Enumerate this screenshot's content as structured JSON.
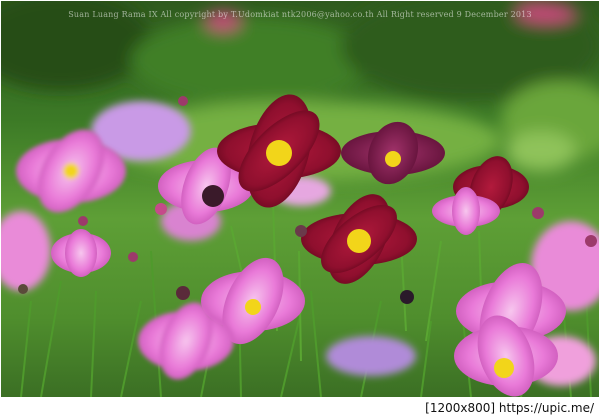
{
  "photo": {
    "description_icon": "cosmos-flower-field-photo",
    "watermark": "Suan Luang Rama IX All copyright by T.Udomkiat ntk2006@yahoo.co.th All Right reserved 9 December 2013"
  },
  "footer": {
    "resolution": "[1200x800]",
    "link": "https://upic.me/"
  },
  "colors": {
    "pink": "#e97ad8",
    "light_pink": "#f3a6e6",
    "crimson": "#8f0f2e",
    "magenta_dark": "#7a1a4c",
    "yellow_center": "#f2d51a"
  }
}
